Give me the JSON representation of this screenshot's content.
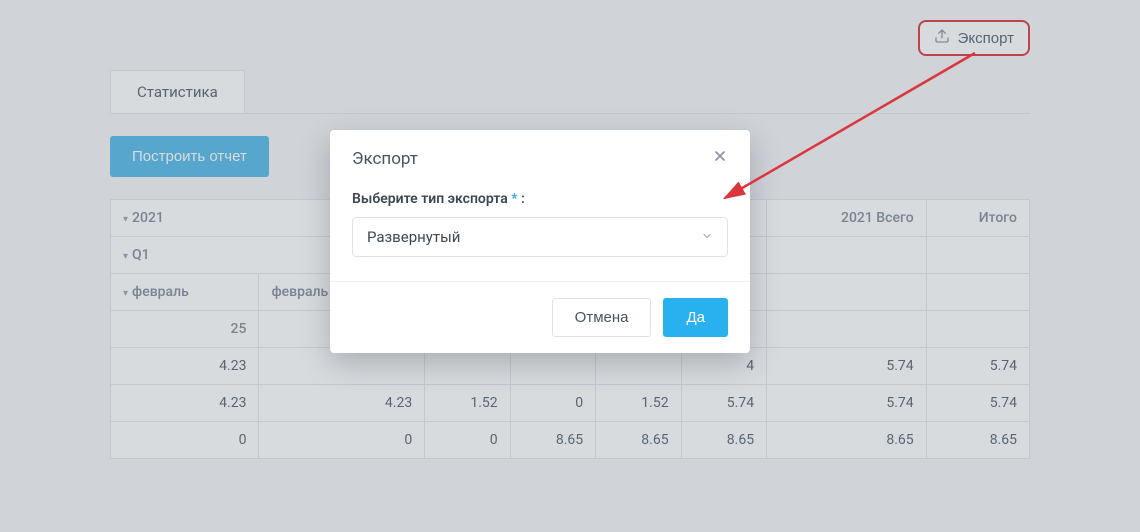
{
  "topbar": {
    "export_label": "Экспорт"
  },
  "tabs": {
    "stats": "Статистика"
  },
  "actions": {
    "build_report": "Построить отчет"
  },
  "table": {
    "header_groups": {
      "year": "2021",
      "q1": "Q1",
      "year_total": "2021 Всего",
      "grand_total": "Итого"
    },
    "columns": {
      "feb": "февраль",
      "feb_total": "февраль Вс"
    },
    "sub_header": {
      "day": "25"
    },
    "rows": [
      {
        "c0": "4.23",
        "c1": "",
        "c2": "",
        "c3": "",
        "c4": "",
        "c5": "",
        "c6": "5.74",
        "c7": "5.74"
      },
      {
        "c0": "4.23",
        "c1": "4.23",
        "c2": "1.52",
        "c3": "0",
        "c4": "1.52",
        "c5": "5.74",
        "c6": "5.74",
        "c7": "5.74"
      },
      {
        "c0": "0",
        "c1": "0",
        "c2": "0",
        "c3": "8.65",
        "c4": "8.65",
        "c5": "8.65",
        "c6": "8.65",
        "c7": "8.65"
      }
    ],
    "hidden_cell": "4"
  },
  "modal": {
    "title": "Экспорт",
    "field_label": "Выберите тип экспорта",
    "required_mark": "*",
    "colon": " :",
    "selected_value": "Развернутый",
    "cancel": "Отмена",
    "confirm": "Да"
  }
}
